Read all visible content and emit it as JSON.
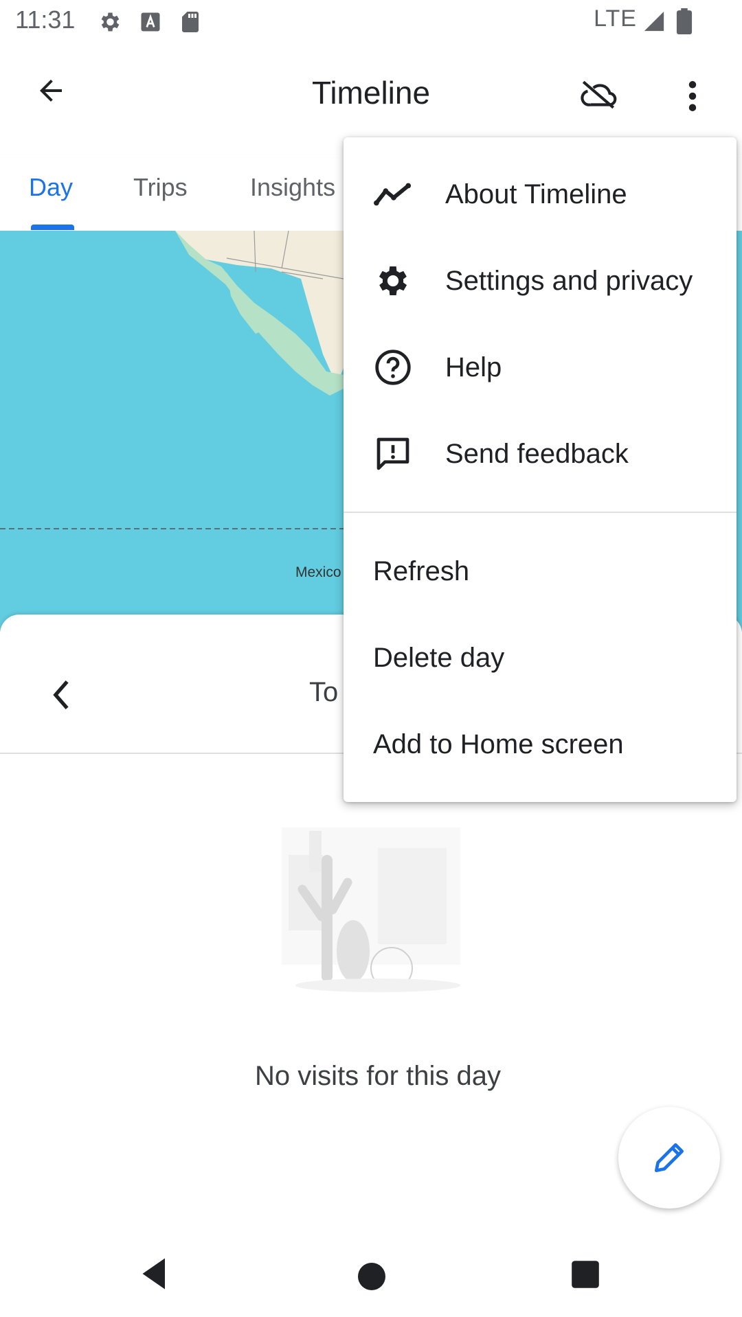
{
  "status_bar": {
    "time": "11:31",
    "network": "LTE",
    "icons": [
      "settings-icon",
      "a-notification-icon",
      "sd-card-icon",
      "signal-icon",
      "battery-icon"
    ]
  },
  "app_bar": {
    "title": "Timeline",
    "icons": [
      "back-arrow-icon",
      "cloud-off-icon",
      "more-vert-icon"
    ]
  },
  "tabs": [
    {
      "label": "Day",
      "selected": true
    },
    {
      "label": "Trips",
      "selected": false
    },
    {
      "label": "Insights",
      "selected": false
    }
  ],
  "map": {
    "place_label": "Mexico"
  },
  "sheet": {
    "date_label_partial": "To",
    "empty_message": "No visits for this day"
  },
  "menu": {
    "items": [
      {
        "label": "About Timeline",
        "icon": "trend-line-icon"
      },
      {
        "label": "Settings and privacy",
        "icon": "gear-icon"
      },
      {
        "label": "Help",
        "icon": "help-circle-icon"
      },
      {
        "label": "Send feedback",
        "icon": "feedback-icon"
      },
      {
        "label": "Refresh"
      },
      {
        "label": "Delete day"
      },
      {
        "label": "Add to Home screen"
      }
    ]
  },
  "colors": {
    "accent": "#1a73e8",
    "map_water": "#62cde0",
    "text_primary": "#202124",
    "text_secondary": "#5f6368"
  }
}
